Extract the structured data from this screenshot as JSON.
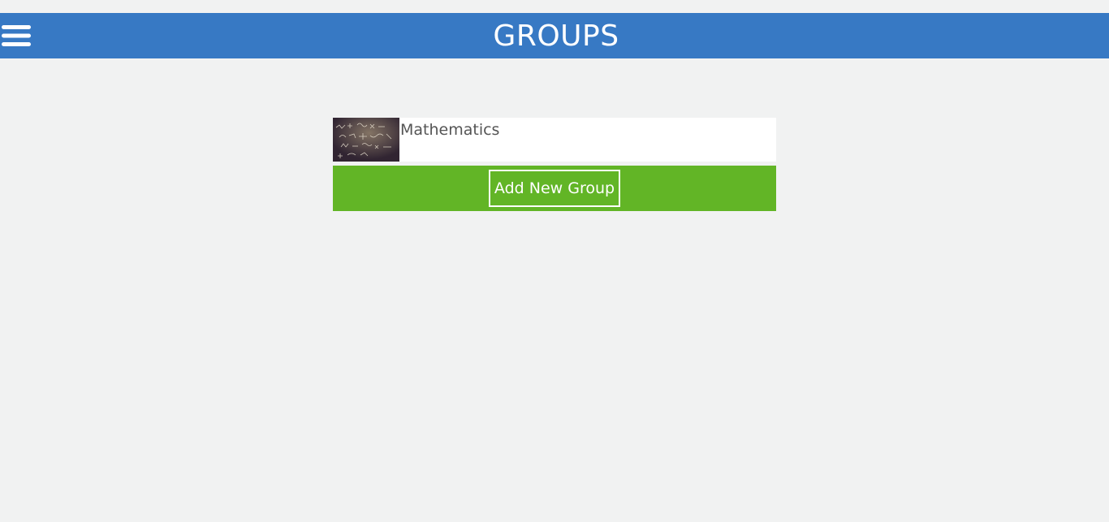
{
  "header": {
    "title": "GROUPS",
    "menu_icon": "hamburger-menu-icon",
    "background": "#3779c4"
  },
  "groups": [
    {
      "name": "Mathematics",
      "thumbnail": "chalkboard-equations-image"
    }
  ],
  "add_group": {
    "label": "Add New Group",
    "background": "#62b526"
  }
}
